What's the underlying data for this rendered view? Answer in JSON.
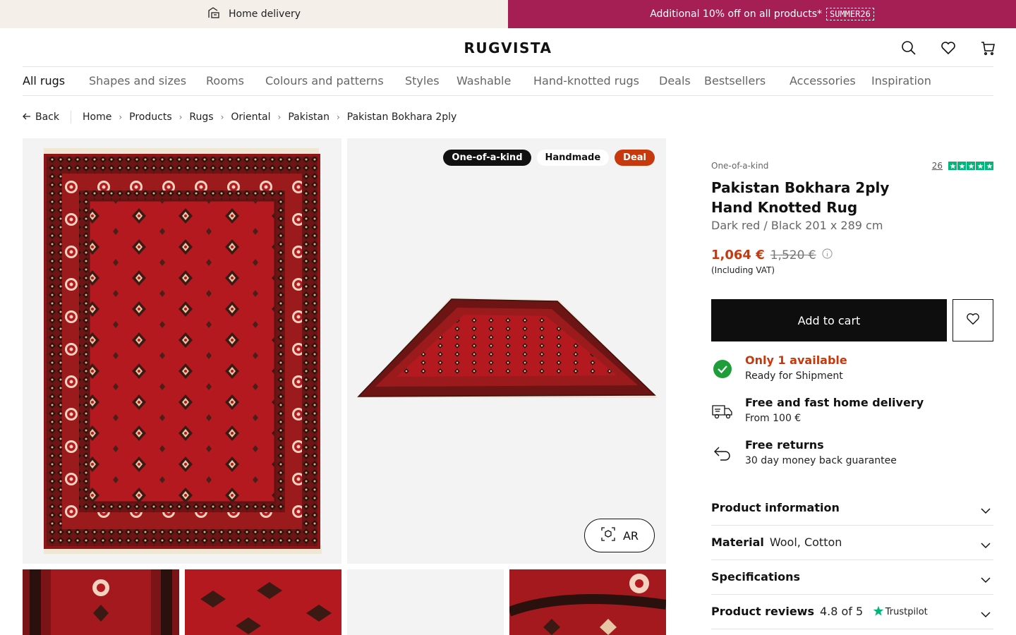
{
  "topbar": {
    "delivery_label": "Home delivery",
    "promo_text": "Additional 10% off on all products*",
    "promo_code": "SUMMER26"
  },
  "header": {
    "logo": "RUGVISTA",
    "icons": [
      "search-icon",
      "heart-icon",
      "cart-icon"
    ]
  },
  "nav": {
    "items": [
      {
        "label": "All rugs"
      },
      {
        "label": "Shapes and sizes"
      },
      {
        "label": "Rooms"
      },
      {
        "label": "Colours and patterns"
      },
      {
        "label": "Styles"
      },
      {
        "label": "Washable"
      },
      {
        "label": "Hand-knotted rugs"
      },
      {
        "label": "Deals"
      },
      {
        "label": "Bestsellers"
      },
      {
        "label": "Accessories"
      },
      {
        "label": "Inspiration"
      }
    ]
  },
  "breadcrumb": {
    "back_label": "Back",
    "items": [
      "Home",
      "Products",
      "Rugs",
      "Oriental",
      "Pakistan",
      "Pakistan Bokhara 2ply"
    ]
  },
  "gallery": {
    "badges": [
      "One-of-a-kind",
      "Handmade",
      "Deal"
    ],
    "ar_label": "AR"
  },
  "product": {
    "eyebrow": "One-of-a-kind",
    "review_count": "26",
    "title_line1": "Pakistan Bokhara 2ply",
    "title_line2": "Hand Knotted Rug",
    "subtitle": "Dark red / Black 201 x 289 cm",
    "price": "1,064 €",
    "old_price": "1,520 €",
    "vat": "(Including VAT)",
    "add_to_cart": "Add to cart",
    "features": [
      {
        "title": "Only 1 available",
        "sub": "Ready for Shipment",
        "icon": "check-circle-icon"
      },
      {
        "title": "Free and fast home delivery",
        "sub": "From 100 €",
        "icon": "delivery-truck-icon"
      },
      {
        "title": "Free returns",
        "sub": "30 day money back guarantee",
        "icon": "return-arrow-icon"
      }
    ],
    "accordions": {
      "info": "Product information",
      "material_label": "Material",
      "material_value": "Wool, Cotton",
      "specs": "Specifications",
      "reviews_label": "Product reviews",
      "reviews_value": "4.8 of 5",
      "trustpilot": "Trustpilot"
    }
  },
  "colors": {
    "promo_bg": "#a51f55",
    "deal_orange": "#c8380d",
    "rug_red": "#b3191f",
    "trust_green": "#00b67a"
  }
}
